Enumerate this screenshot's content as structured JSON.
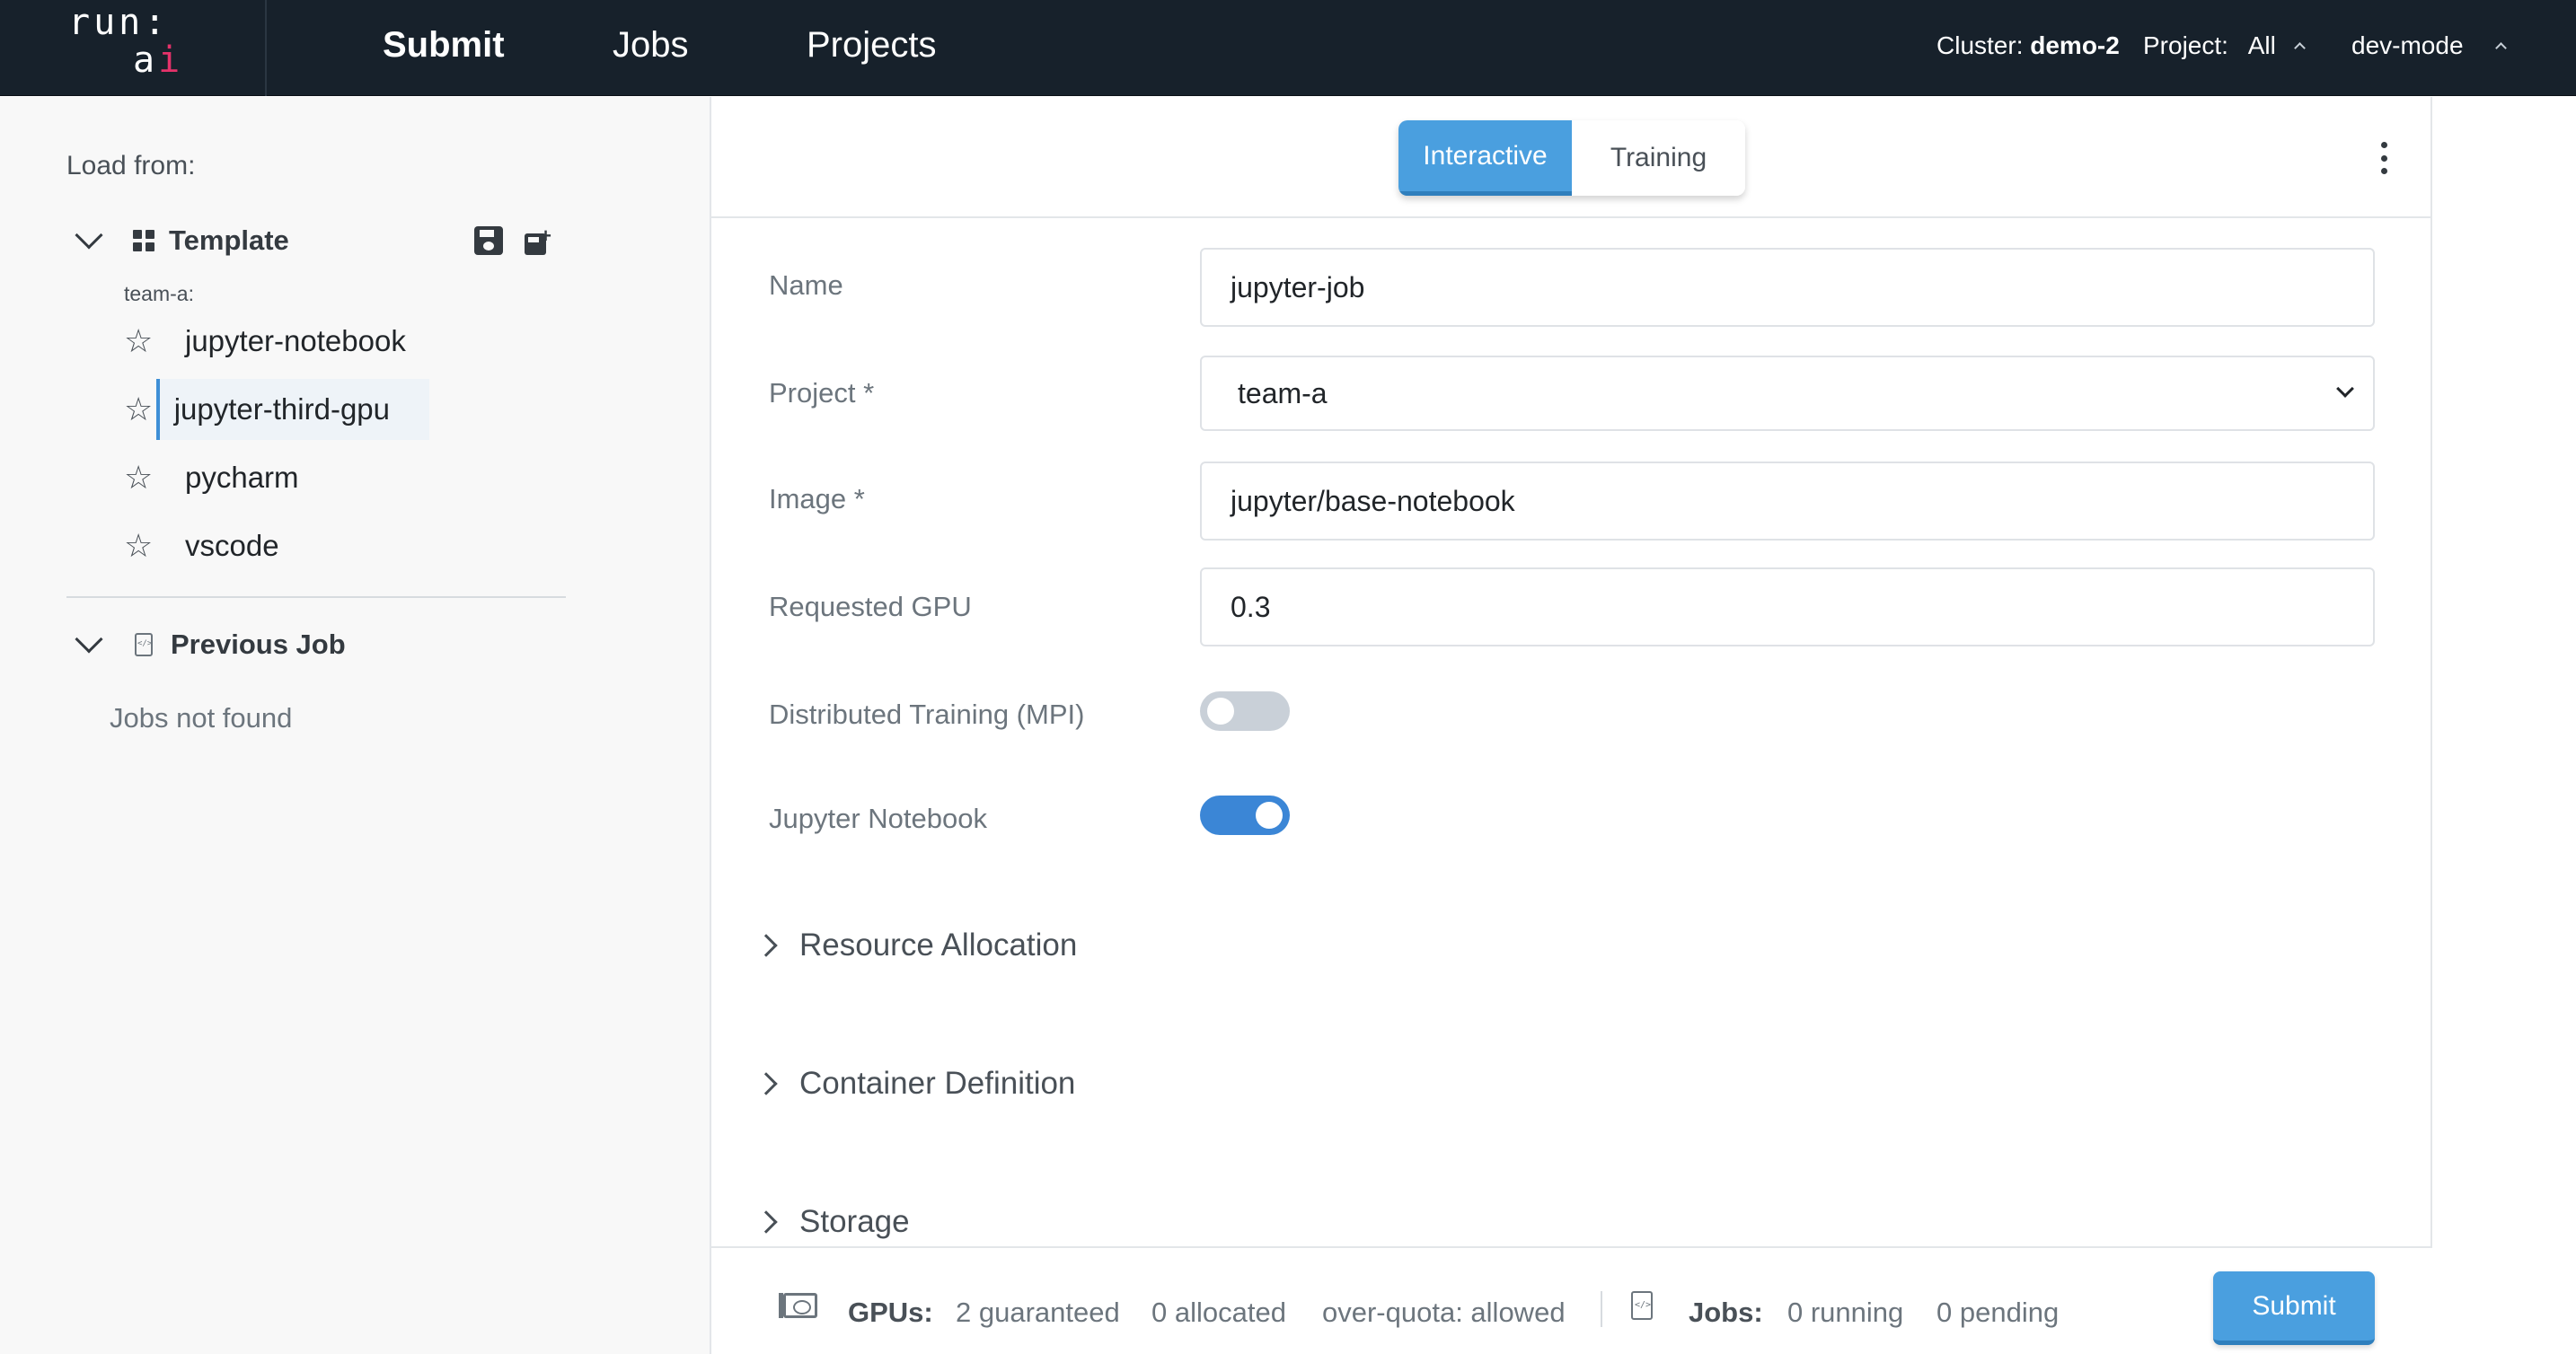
{
  "header": {
    "logo_top": "run:",
    "logo_bottom_a": "a",
    "logo_bottom_i": "i",
    "nav": [
      "Submit",
      "Jobs",
      "Projects"
    ],
    "cluster_label": "Cluster:",
    "cluster_value": "demo-2",
    "project_label": "Project:",
    "project_value": "All",
    "user": "dev-mode"
  },
  "sidebar": {
    "load_from": "Load from:",
    "template_section": "Template",
    "group_label": "team-a:",
    "templates": [
      "jupyter-notebook",
      "jupyter-third-gpu",
      "pycharm",
      "vscode"
    ],
    "selected_template": "jupyter-third-gpu",
    "previous_job_section": "Previous Job",
    "jobs_empty": "Jobs not found"
  },
  "main": {
    "mode_tabs": [
      "Interactive",
      "Training"
    ],
    "active_mode": "Interactive",
    "fields": {
      "name_label": "Name",
      "name_value": "jupyter-job",
      "project_label": "Project *",
      "project_value": "team-a",
      "image_label": "Image *",
      "image_value": "jupyter/base-notebook",
      "gpu_label": "Requested GPU",
      "gpu_value": "0.3",
      "mpi_label": "Distributed Training (MPI)",
      "mpi_enabled": false,
      "jupyter_label": "Jupyter Notebook",
      "jupyter_enabled": true
    },
    "sections": [
      "Resource Allocation",
      "Container Definition",
      "Storage"
    ]
  },
  "footer": {
    "gpus_label": "GPUs:",
    "guaranteed": "2 guaranteed",
    "allocated": "0 allocated",
    "over_quota": "over-quota: allowed",
    "jobs_label": "Jobs:",
    "running": "0 running",
    "pending": "0 pending",
    "submit_label": "Submit"
  },
  "colors": {
    "topbar": "#17212b",
    "accent": "#4a9fdf",
    "logo_accent": "#e5326a"
  }
}
